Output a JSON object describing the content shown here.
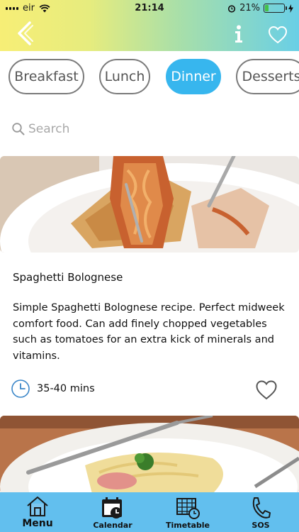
{
  "status_bar": {
    "carrier": "eir",
    "time": "21:14",
    "battery_percent": "21%",
    "battery_level": 0.21,
    "battery_color": "#44c24a"
  },
  "header": {
    "back_icon": "chevron-left-icon",
    "info_icon": "info-icon",
    "favorite_icon": "heart-outline-icon"
  },
  "categories": [
    {
      "label": "Breakfast",
      "active": false
    },
    {
      "label": "Lunch",
      "active": false
    },
    {
      "label": "Dinner",
      "active": true
    },
    {
      "label": "Desserts",
      "active": false
    }
  ],
  "search": {
    "placeholder": "Search",
    "value": ""
  },
  "recipes": [
    {
      "title": "Spaghetti Bolognese",
      "description": "Simple Spaghetti Bolognese recipe. Perfect midweek comfort food. Can add finely chopped vegetables such as tomatoes for an extra kick of minerals and vitamins.",
      "time": "35-40 mins",
      "favorite": false
    }
  ],
  "tab_bar": {
    "items": [
      {
        "label": "Menu",
        "icon": "home-icon",
        "active": true
      },
      {
        "label": "Calendar",
        "icon": "calendar-icon",
        "active": false
      },
      {
        "label": "Timetable",
        "icon": "timetable-icon",
        "active": false
      },
      {
        "label": "SOS",
        "icon": "phone-icon",
        "active": false
      }
    ]
  },
  "colors": {
    "accent": "#37b6ee",
    "tab_bar": "#62bfee",
    "header_gradient_start": "#f7ee76",
    "header_gradient_end": "#69cfe6"
  }
}
